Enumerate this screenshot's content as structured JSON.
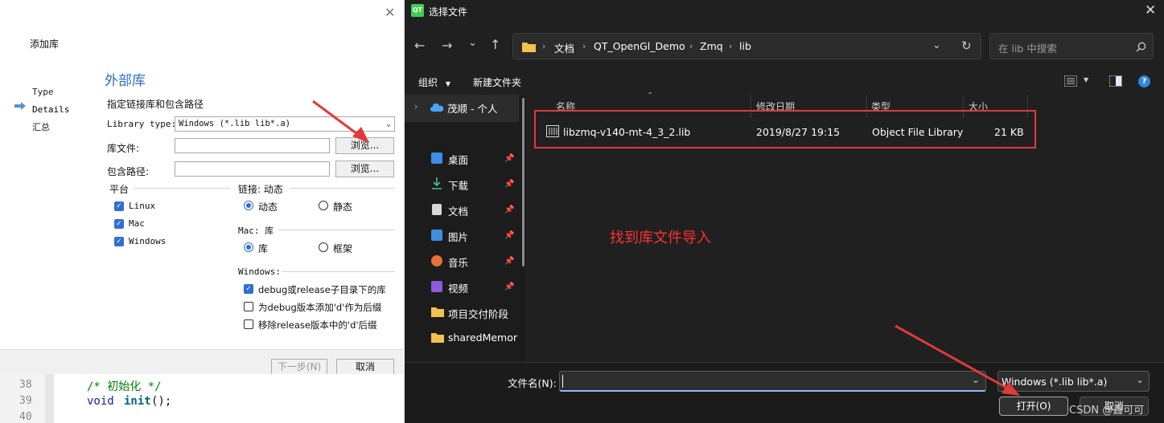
{
  "wizard": {
    "close_glyph": "✕",
    "title": "添加库",
    "steps": [
      "Type",
      "Details",
      "汇总"
    ],
    "section_title": "外部库",
    "section_subtitle": "指定链接库和包含路径",
    "library_type_label": "Library type:",
    "library_type_value": "Windows (*.lib lib*.a)",
    "lib_file_label": "库文件:",
    "include_path_label": "包含路径:",
    "browse_label": "浏览...",
    "platform_group": "平台",
    "platforms": [
      "Linux",
      "Mac",
      "Windows"
    ],
    "linking_group": "链接: 动态",
    "linking_options": [
      "动态",
      "静态"
    ],
    "mac_group": "Mac: 库",
    "mac_options": [
      "库",
      "框架"
    ],
    "windows_group": "Windows:",
    "windows_options": [
      "debug或release子目录下的库",
      "为debug版本添加'd'作为后缀",
      "移除release版本中的'd'后缀"
    ],
    "next_label": "下一步(N)",
    "cancel_label": "取消"
  },
  "code_editor": {
    "line_numbers": [
      "38",
      "39",
      "40"
    ],
    "line_38": "/* 初始化 */",
    "line_39_kw": "void",
    "line_39_fn": "init",
    "line_39_rest": "();"
  },
  "file_dialog": {
    "title": "选择文件",
    "logo_text": "QT",
    "close_glyph": "✕",
    "breadcrumbs": [
      "文档",
      "QT_OpenGl_Demo",
      "Zmq",
      "lib"
    ],
    "search_placeholder": "在 lib 中搜索",
    "organize_label": "组织",
    "new_folder_label": "新建文件夹",
    "sidebar_items": [
      {
        "label": "茂顺 - 个人",
        "icon": "cloud-icon"
      },
      {
        "label": "桌面",
        "icon": "desktop-icon",
        "pinned": true
      },
      {
        "label": "下载",
        "icon": "download-icon",
        "pinned": true
      },
      {
        "label": "文档",
        "icon": "document-icon",
        "pinned": true
      },
      {
        "label": "图片",
        "icon": "pictures-icon",
        "pinned": true
      },
      {
        "label": "音乐",
        "icon": "music-icon",
        "pinned": true
      },
      {
        "label": "视频",
        "icon": "video-icon",
        "pinned": true
      },
      {
        "label": "项目交付阶段",
        "icon": "folder-icon"
      },
      {
        "label": "sharedMemor",
        "icon": "folder-icon"
      }
    ],
    "columns": [
      "名称",
      "修改日期",
      "类型",
      "大小"
    ],
    "files": [
      {
        "name": "libzmq-v140-mt-4_3_2.lib",
        "modified": "2019/8/27 19:15",
        "type": "Object File Library",
        "size": "21 KB"
      }
    ],
    "annotation": "找到库文件导入",
    "filename_label": "文件名(N):",
    "filename_value": "",
    "filter_value": "Windows (*.lib lib*.a)",
    "open_label": "打开(O)",
    "cancel_label": "取消",
    "watermark": "CSDN @鑫可可"
  },
  "colors": {
    "accent_blue": "#2f6fd0",
    "annotation_red": "#e23a3a",
    "dialog_bg": "#202020"
  }
}
